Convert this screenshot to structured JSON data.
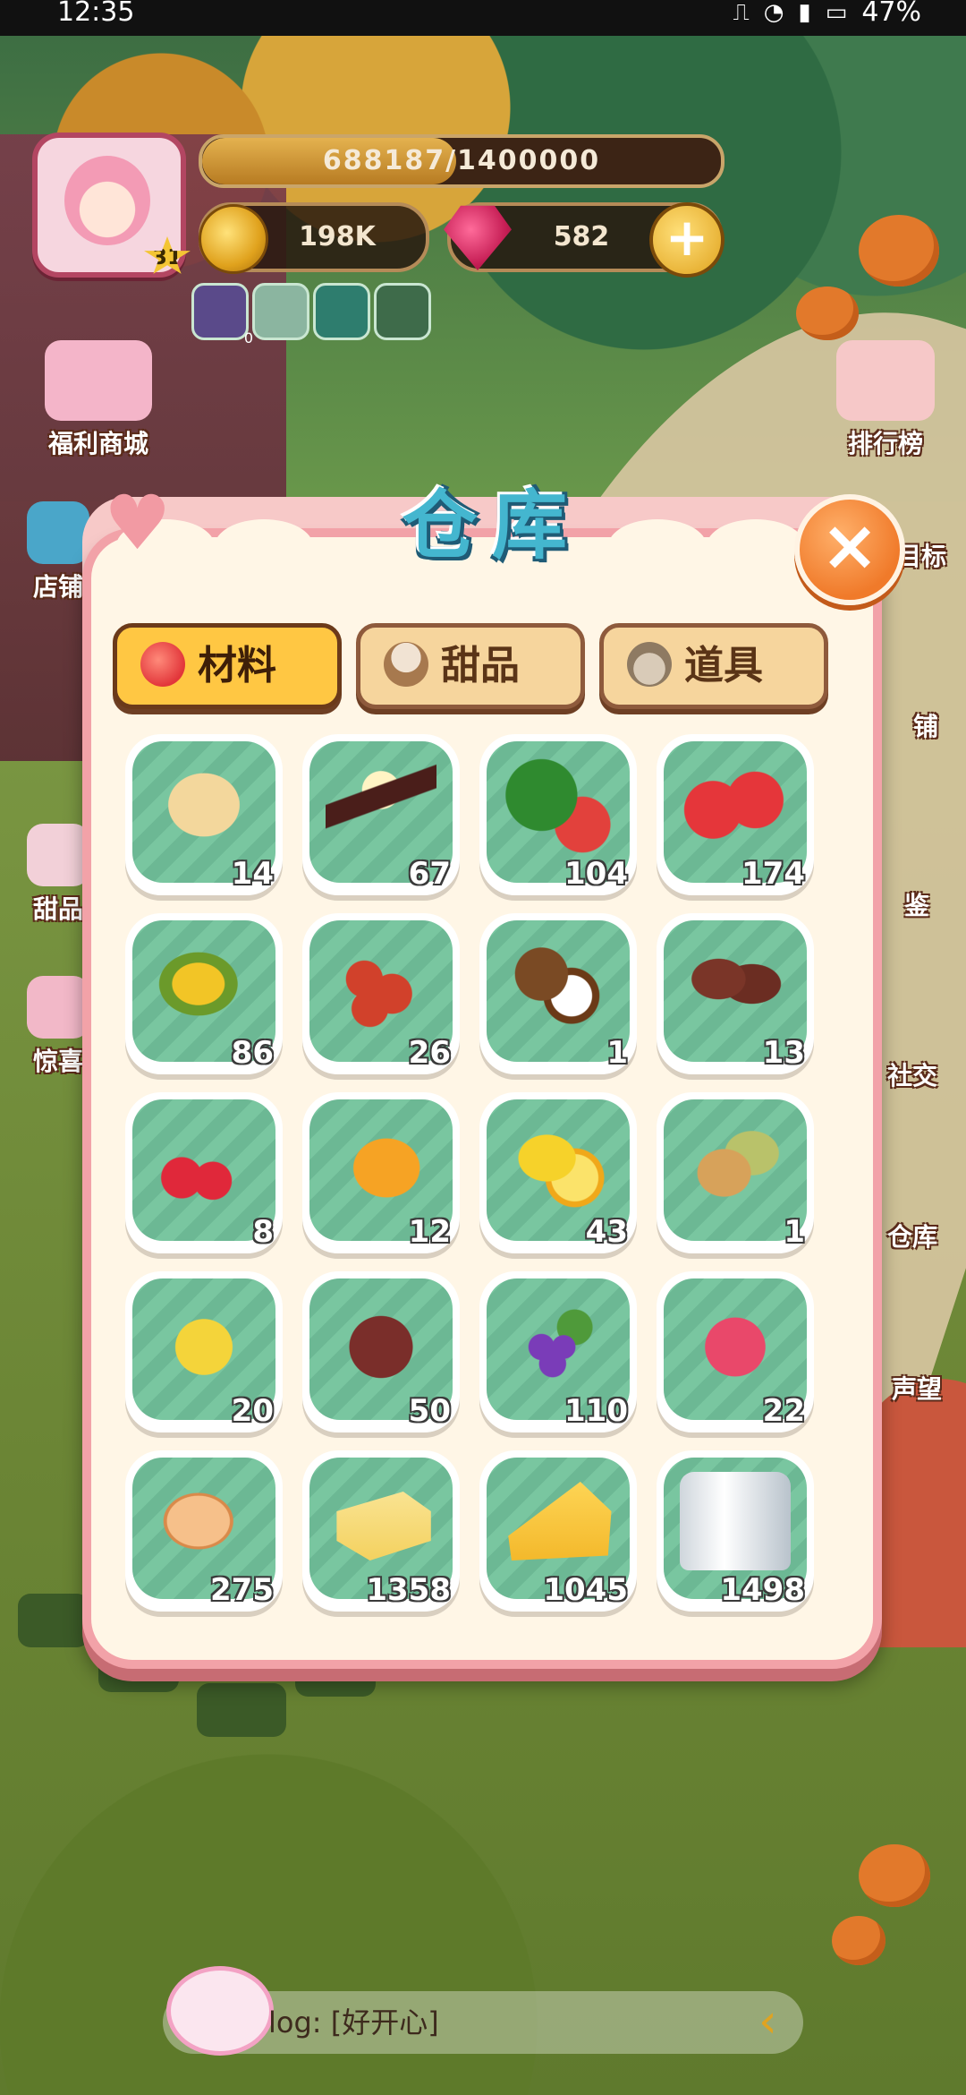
{
  "status_bar": {
    "time": "12:35",
    "battery": "47%"
  },
  "hud": {
    "level": "31",
    "xp": "688187/1400000",
    "xp_fraction": 0.49,
    "coins": "198K",
    "gems": "582",
    "buff_count": "0"
  },
  "side_menu_left": [
    "福利商城",
    "店铺",
    "甜品",
    "惊喜"
  ],
  "side_menu_right": [
    "排行榜",
    "目标",
    "铺",
    "鉴",
    "社交",
    "仓库",
    "声望"
  ],
  "warehouse": {
    "title": "仓库",
    "tabs": [
      {
        "label": "材料",
        "icon": "tomato-icon",
        "active": true
      },
      {
        "label": "甜品",
        "icon": "cupcake-icon",
        "active": false
      },
      {
        "label": "道具",
        "icon": "pot-icon",
        "active": false
      }
    ],
    "items": [
      {
        "icon": "wheat-icon",
        "count": "14"
      },
      {
        "icon": "vanilla-icon",
        "count": "67"
      },
      {
        "icon": "watermelon-icon",
        "count": "104"
      },
      {
        "icon": "strawberry-icon",
        "count": "174"
      },
      {
        "icon": "corn-icon",
        "count": "86"
      },
      {
        "icon": "cranberry-icon",
        "count": "26"
      },
      {
        "icon": "coconut-icon",
        "count": "1"
      },
      {
        "icon": "cocoa-bean-icon",
        "count": "13"
      },
      {
        "icon": "cherry-icon",
        "count": "8"
      },
      {
        "icon": "mango-icon",
        "count": "12"
      },
      {
        "icon": "lemon-icon",
        "count": "43"
      },
      {
        "icon": "almond-icon",
        "count": "1"
      },
      {
        "icon": "banana-icon",
        "count": "20"
      },
      {
        "icon": "sweet-potato-icon",
        "count": "50"
      },
      {
        "icon": "grape-icon",
        "count": "110"
      },
      {
        "icon": "dragon-fruit-icon",
        "count": "22"
      },
      {
        "icon": "egg-icon",
        "count": "275"
      },
      {
        "icon": "butter-icon",
        "count": "1358"
      },
      {
        "icon": "cheese-icon",
        "count": "1045"
      },
      {
        "icon": "salt-icon",
        "count": "1498"
      }
    ]
  },
  "chat": {
    "text": "log: [好开心]"
  }
}
